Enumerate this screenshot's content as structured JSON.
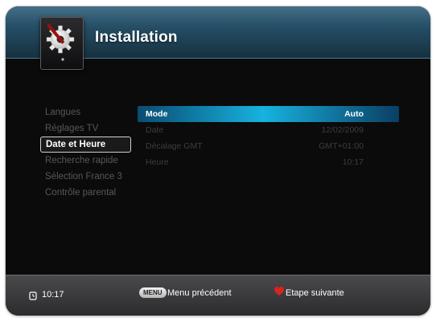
{
  "header": {
    "title": "Installation",
    "logo_icon": "gear-screwdriver-icon"
  },
  "sidebar": {
    "items": [
      {
        "label": "Langues"
      },
      {
        "label": "Réglages TV"
      },
      {
        "label": "Date et Heure"
      },
      {
        "label": "Recherche rapide"
      },
      {
        "label": "Sélection France 3"
      },
      {
        "label": "Contrôle parental"
      }
    ]
  },
  "main": {
    "rows": [
      {
        "label": "Mode",
        "value": "Auto"
      },
      {
        "label": "Date",
        "value": "12/02/2009"
      },
      {
        "label": "Décalage GMT",
        "value": "GMT+01:00"
      },
      {
        "label": "Heure",
        "value": "10:17"
      }
    ]
  },
  "footer": {
    "clock": "10:17",
    "menu_key": "MENU",
    "menu_action": "Menu précédent",
    "next_action": "Etape suivante"
  },
  "colors": {
    "header_blue": "#22485e",
    "highlight_cyan": "#17b2df",
    "background": "#0b0b0c",
    "footer_grey": "#3a3a3d",
    "accent_red": "#d8241c"
  }
}
